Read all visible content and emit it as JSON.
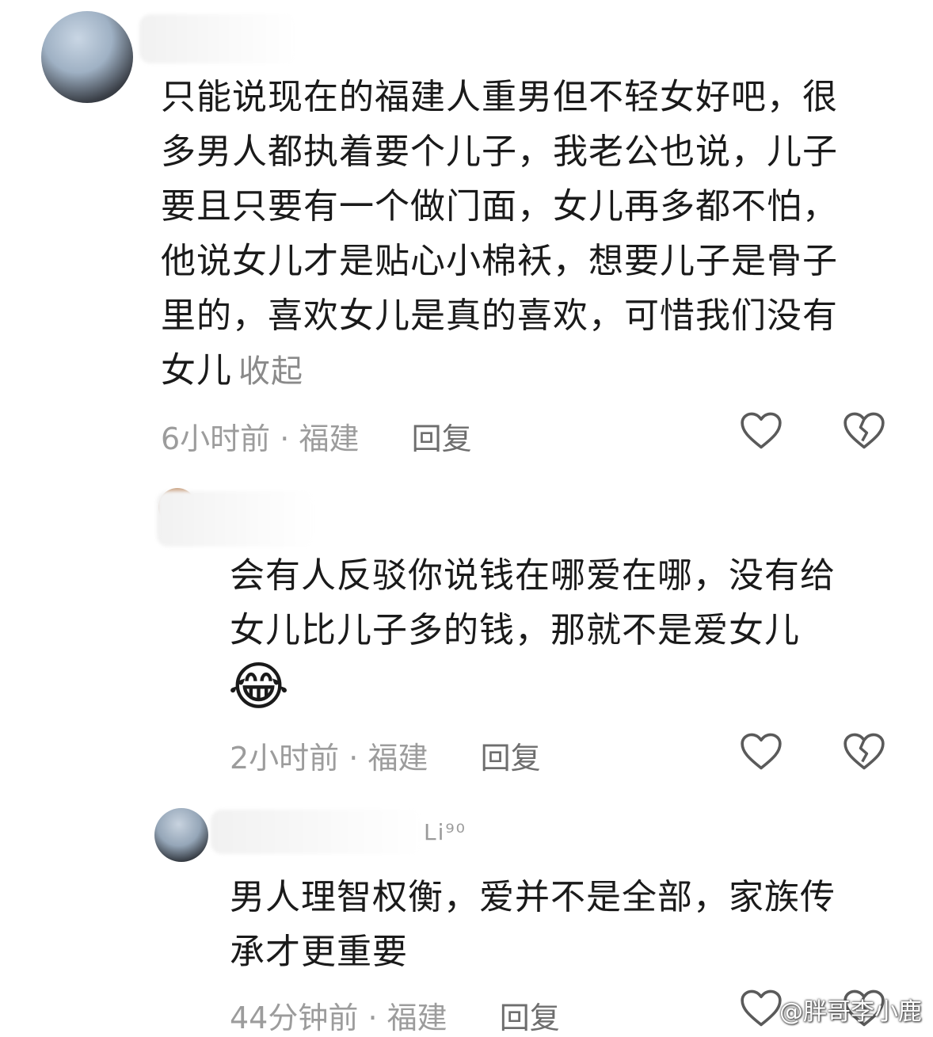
{
  "comments": [
    {
      "text_lines": [
        "只能说现在的福建人重男但不轻女好吧，很",
        "多男人都执着要个儿子，我老公也说，儿子",
        "要且只要有一个做门面，女儿再多都不怕，",
        "他说女儿才是贴心小棉袄，想要儿子是骨子",
        "里的，喜欢女儿是真的喜欢，可惜我们没有",
        "女儿"
      ],
      "collapse_label": "收起",
      "time": "6小时前",
      "separator": "·",
      "location": "福建",
      "reply_label": "回复"
    },
    {
      "text_lines": [
        "会有人反驳你说钱在哪爱在哪，没有给",
        "女儿比儿子多的钱，那就不是爱女儿"
      ],
      "emoji": "😂",
      "time": "2小时前",
      "separator": "·",
      "location": "福建",
      "reply_label": "回复"
    },
    {
      "username_suffix": "Li⁹⁰",
      "text_lines": [
        "男人理智权衡，爱并不是全部，家族传",
        "承才更重要"
      ],
      "time": "44分钟前",
      "separator": "·",
      "location": "福建",
      "reply_label": "回复"
    }
  ],
  "watermark": "@胖哥李小鹿",
  "icons": {
    "like": "heart-outline-icon",
    "dislike": "broken-heart-icon"
  },
  "colors": {
    "text": "#1a1a1a",
    "meta": "#9c9c9c",
    "reply": "#6e6e6e",
    "icon_stroke": "#5a5a5a"
  }
}
